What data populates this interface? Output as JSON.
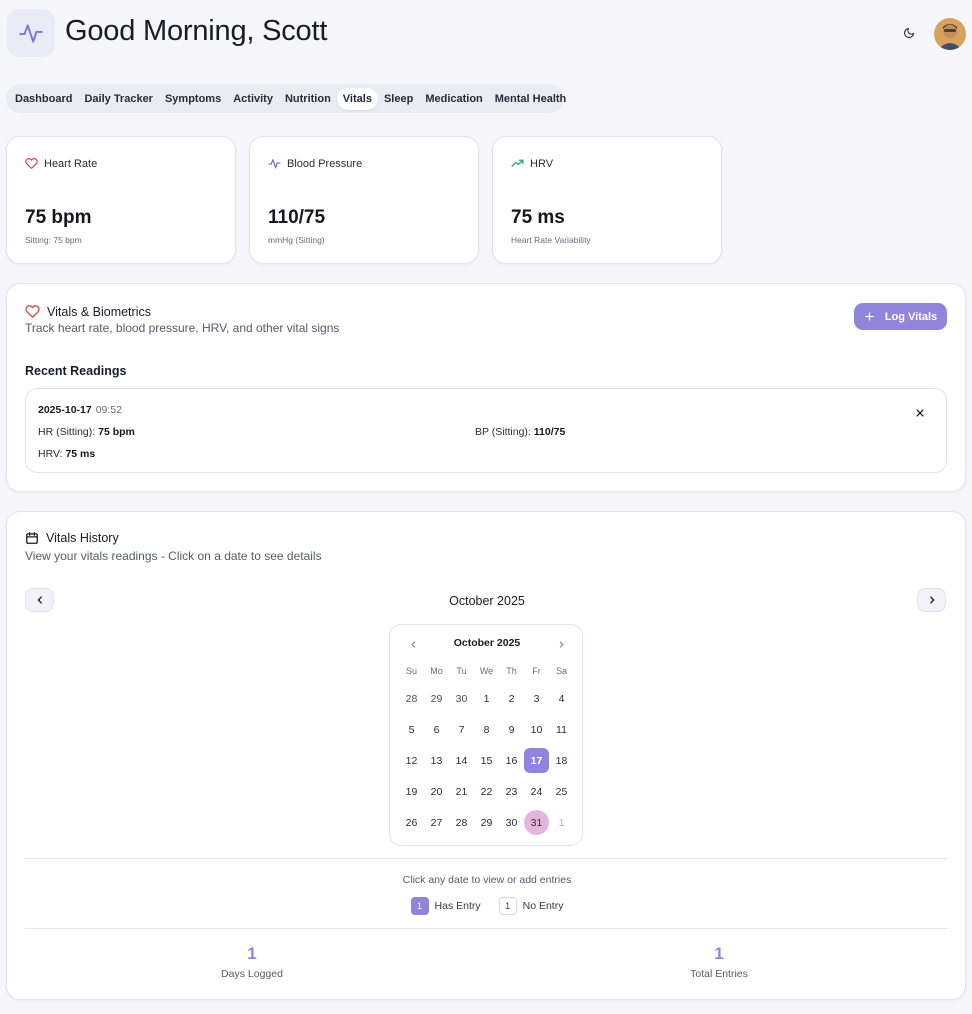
{
  "header": {
    "greeting": "Good Morning, Scott"
  },
  "tabs": [
    "Dashboard",
    "Daily Tracker",
    "Symptoms",
    "Activity",
    "Nutrition",
    "Vitals",
    "Sleep",
    "Medication",
    "Mental Health"
  ],
  "active_tab": "Vitals",
  "stats": {
    "heart_rate": {
      "label": "Heart Rate",
      "value": "75 bpm",
      "sub": "Sitting: 75 bpm",
      "icon": "heart-icon",
      "color": "#e04848"
    },
    "blood_pressure": {
      "label": "Blood Pressure",
      "value": "110/75",
      "sub": "mmHg (Sitting)",
      "icon": "activity-icon",
      "color": "#6a6ad8"
    },
    "hrv": {
      "label": "HRV",
      "value": "75 ms",
      "sub": "Heart Rate Variability",
      "icon": "trending-up-icon",
      "color": "#2ea86a"
    }
  },
  "vitals_panel": {
    "title": "Vitals & Biometrics",
    "description": "Track heart rate, blood pressure, HRV, and other vital signs",
    "log_button": "Log Vitals",
    "recent_label": "Recent Readings",
    "reading": {
      "date": "2025-10-17",
      "time": "09:52",
      "hr_label": "HR (Sitting):",
      "hr_value": "75 bpm",
      "bp_label": "BP (Sitting):",
      "bp_value": "110/75",
      "hrv_label": "HRV:",
      "hrv_value": "75 ms"
    }
  },
  "history_panel": {
    "title": "Vitals History",
    "description": "View your vitals readings - Click on a date to see details",
    "month_label": "October 2025",
    "calendar": {
      "header": "October 2025",
      "weekdays": [
        "Su",
        "Mo",
        "Tu",
        "We",
        "Th",
        "Fr",
        "Sa"
      ],
      "days": [
        {
          "d": "28",
          "s": "outside"
        },
        {
          "d": "29",
          "s": "outside"
        },
        {
          "d": "30",
          "s": "outside"
        },
        {
          "d": "1",
          "s": ""
        },
        {
          "d": "2",
          "s": ""
        },
        {
          "d": "3",
          "s": ""
        },
        {
          "d": "4",
          "s": ""
        },
        {
          "d": "5",
          "s": ""
        },
        {
          "d": "6",
          "s": ""
        },
        {
          "d": "7",
          "s": ""
        },
        {
          "d": "8",
          "s": ""
        },
        {
          "d": "9",
          "s": ""
        },
        {
          "d": "10",
          "s": ""
        },
        {
          "d": "11",
          "s": ""
        },
        {
          "d": "12",
          "s": ""
        },
        {
          "d": "13",
          "s": ""
        },
        {
          "d": "14",
          "s": ""
        },
        {
          "d": "15",
          "s": ""
        },
        {
          "d": "16",
          "s": ""
        },
        {
          "d": "17",
          "s": "selected"
        },
        {
          "d": "18",
          "s": ""
        },
        {
          "d": "19",
          "s": ""
        },
        {
          "d": "20",
          "s": ""
        },
        {
          "d": "21",
          "s": ""
        },
        {
          "d": "22",
          "s": ""
        },
        {
          "d": "23",
          "s": ""
        },
        {
          "d": "24",
          "s": ""
        },
        {
          "d": "25",
          "s": ""
        },
        {
          "d": "26",
          "s": ""
        },
        {
          "d": "27",
          "s": ""
        },
        {
          "d": "28",
          "s": ""
        },
        {
          "d": "29",
          "s": ""
        },
        {
          "d": "30",
          "s": ""
        },
        {
          "d": "31",
          "s": "today"
        },
        {
          "d": "1",
          "s": "muted"
        }
      ]
    },
    "hint": "Click any date to view or add entries",
    "legend": {
      "has_entry_swatch": "1",
      "has_entry": "Has Entry",
      "no_entry_swatch": "1",
      "no_entry": "No Entry"
    },
    "summary": {
      "days_logged_value": "1",
      "days_logged_label": "Days Logged",
      "total_entries_value": "1",
      "total_entries_label": "Total Entries"
    }
  },
  "colors": {
    "accent": "#8f86dc",
    "today_highlight": "#e5b6dd",
    "background": "#f6f6fb"
  }
}
